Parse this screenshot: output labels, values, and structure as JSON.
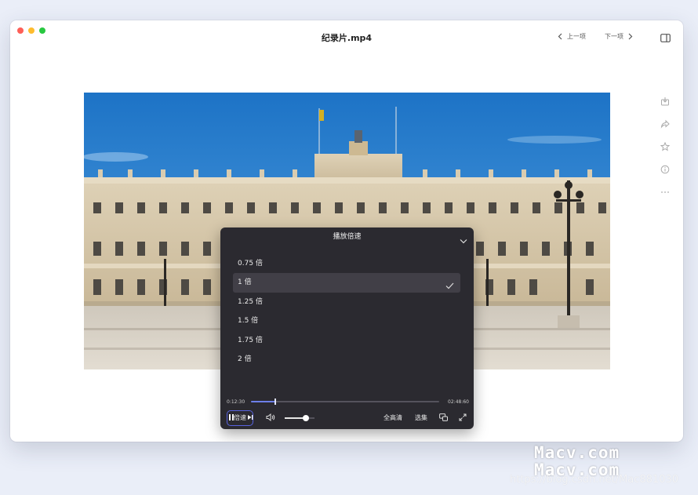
{
  "window": {
    "title": "纪录片.mp4",
    "prev_label": "上一项",
    "next_label": "下一项"
  },
  "side_actions": [
    "download-icon",
    "share-icon",
    "star-icon",
    "info-icon",
    "more-icon"
  ],
  "speed_panel": {
    "title": "播放倍速",
    "options": [
      "0.75 倍",
      "1 倍",
      "1.25 倍",
      "1.5 倍",
      "1.75 倍",
      "2 倍"
    ],
    "selected": "1 倍"
  },
  "player": {
    "time_current": "0:12:30",
    "time_total": "02:48:60",
    "progress_fraction": 0.13,
    "volume_fraction": 0.7,
    "speed_label": "倍速",
    "quality_label": "全高清",
    "episodes_label": "选集"
  },
  "watermark": {
    "line1": "Macv.com",
    "line2": "Macv.com",
    "url": "https://blog.csdn.net/Mac881030"
  },
  "colors": {
    "accent": "#5863df",
    "panel_bg": "#2b2a30"
  }
}
